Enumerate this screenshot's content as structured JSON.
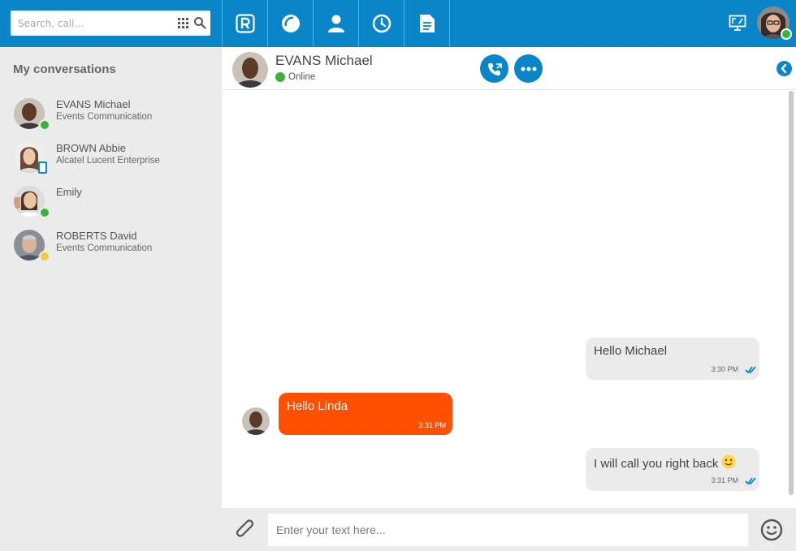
{
  "search": {
    "placeholder": "Search, call..."
  },
  "nav_icons": [
    "rainbow-logo-icon",
    "bubble-chart-icon",
    "contacts-icon",
    "recent-calls-icon",
    "files-icon"
  ],
  "sidebar": {
    "title": "My conversations",
    "conversations": [
      {
        "name": "EVANS Michael",
        "company": "Events Communication",
        "status": "online",
        "status_color": "#3bb33b"
      },
      {
        "name": "BROWN Abbie",
        "company": "Alcatel Lucent Enterprise",
        "status": "mobile",
        "status_color": "#0a85c8"
      },
      {
        "name": "Emily",
        "company": "",
        "status": "online",
        "status_color": "#3bb33b"
      },
      {
        "name": "ROBERTS David",
        "company": "Events Communication",
        "status": "away",
        "status_color": "#f5c842"
      }
    ]
  },
  "chat": {
    "contact_name": "EVANS Michael",
    "presence": "Online",
    "messages": [
      {
        "direction": "out",
        "text": "Hello Michael",
        "time": "3:30 PM"
      },
      {
        "direction": "in",
        "text": "Hello Linda",
        "time": "3:31 PM"
      },
      {
        "direction": "out",
        "text": "I will call you right back",
        "time": "3:31 PM",
        "emoji": "smiley"
      }
    ],
    "input_placeholder": "Enter your text here..."
  },
  "colors": {
    "brand": "#0a85c8",
    "incoming_bubble": "#ff4f00",
    "outgoing_bubble": "#ebebeb",
    "online": "#3bb33b",
    "away": "#f5c842"
  }
}
